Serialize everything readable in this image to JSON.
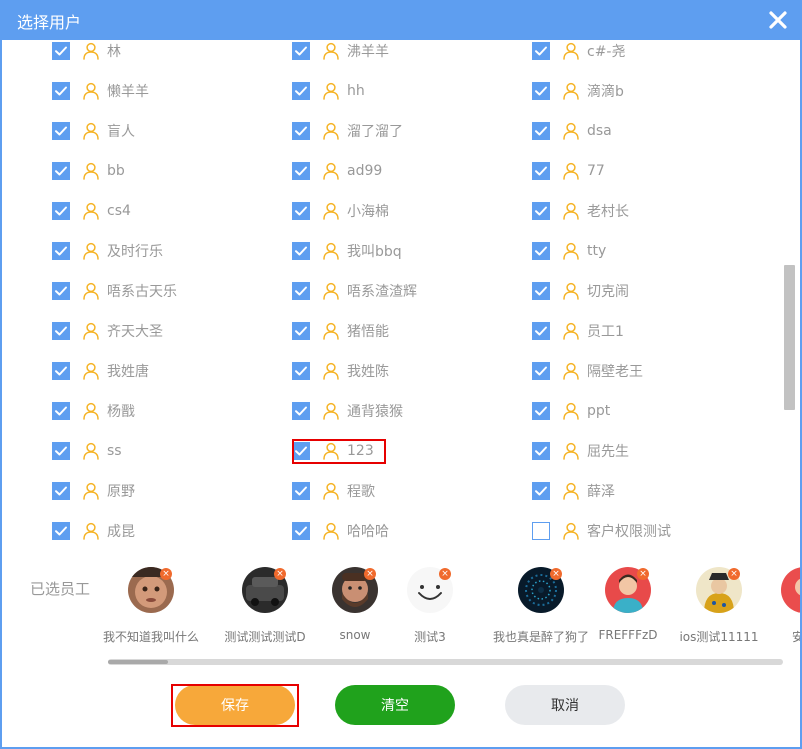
{
  "dialog": {
    "title": "选择用户",
    "close_icon": "close-icon"
  },
  "colors": {
    "title_bar": "#5e9ef0",
    "checkbox": "#5e9ef0",
    "user_icon": "#f5b324",
    "save": "#f7a83a",
    "clear": "#20a21c",
    "cancel": "#e8eaed",
    "highlight": "#e60000",
    "remove_badge": "#f06a2d"
  },
  "users": [
    {
      "name": "林",
      "checked": true
    },
    {
      "name": "沸羊羊",
      "checked": true
    },
    {
      "name": "c#-尧",
      "checked": true
    },
    {
      "name": "懒羊羊",
      "checked": true
    },
    {
      "name": "hh",
      "checked": true
    },
    {
      "name": "滴滴b",
      "checked": true
    },
    {
      "name": "盲人",
      "checked": true
    },
    {
      "name": "溜了溜了",
      "checked": true
    },
    {
      "name": "dsa",
      "checked": true
    },
    {
      "name": "bb",
      "checked": true
    },
    {
      "name": "ad99",
      "checked": true
    },
    {
      "name": "77",
      "checked": true
    },
    {
      "name": "cs4",
      "checked": true
    },
    {
      "name": "小海棉",
      "checked": true
    },
    {
      "name": "老村长",
      "checked": true
    },
    {
      "name": "及时行乐",
      "checked": true
    },
    {
      "name": "我叫bbq",
      "checked": true
    },
    {
      "name": "tty",
      "checked": true
    },
    {
      "name": "唔系古天乐",
      "checked": true
    },
    {
      "name": "唔系渣渣辉",
      "checked": true
    },
    {
      "name": "切克闹",
      "checked": true
    },
    {
      "name": "齐天大圣",
      "checked": true
    },
    {
      "name": "猪悟能",
      "checked": true
    },
    {
      "name": "员工1",
      "checked": true
    },
    {
      "name": "我姓唐",
      "checked": true
    },
    {
      "name": "我姓陈",
      "checked": true
    },
    {
      "name": "隔壁老王",
      "checked": true
    },
    {
      "name": "杨戬",
      "checked": true
    },
    {
      "name": "通背猿猴",
      "checked": true
    },
    {
      "name": "ppt",
      "checked": true
    },
    {
      "name": "ss",
      "checked": true
    },
    {
      "name": "123",
      "checked": true
    },
    {
      "name": "屈先生",
      "checked": true
    },
    {
      "name": "原野",
      "checked": true
    },
    {
      "name": "程歌",
      "checked": true
    },
    {
      "name": "薛泽",
      "checked": true
    },
    {
      "name": "成昆",
      "checked": true
    },
    {
      "name": "哈哈哈",
      "checked": true
    },
    {
      "name": "客户权限测试",
      "checked": false
    }
  ],
  "selected": {
    "label": "已选员工",
    "items": [
      {
        "name": "我不知道我叫什么",
        "avatar": "face-photo"
      },
      {
        "name": "测试测试测试D",
        "avatar": "car-photo"
      },
      {
        "name": "snow",
        "avatar": "bearded-man-photo"
      },
      {
        "name": "测试3",
        "avatar": "smiley-face"
      },
      {
        "name": "我也真是醉了狗了",
        "avatar": "dark-tunnel-photo"
      },
      {
        "name": "FREFFFzD",
        "avatar": "cartoon-person"
      },
      {
        "name": "ios测试11111",
        "avatar": "emperor-painting"
      },
      {
        "name": "安卓",
        "avatar": "red-avatar"
      }
    ],
    "remove_icon": "×"
  },
  "buttons": {
    "save": "保存",
    "clear": "清空",
    "cancel": "取消"
  }
}
